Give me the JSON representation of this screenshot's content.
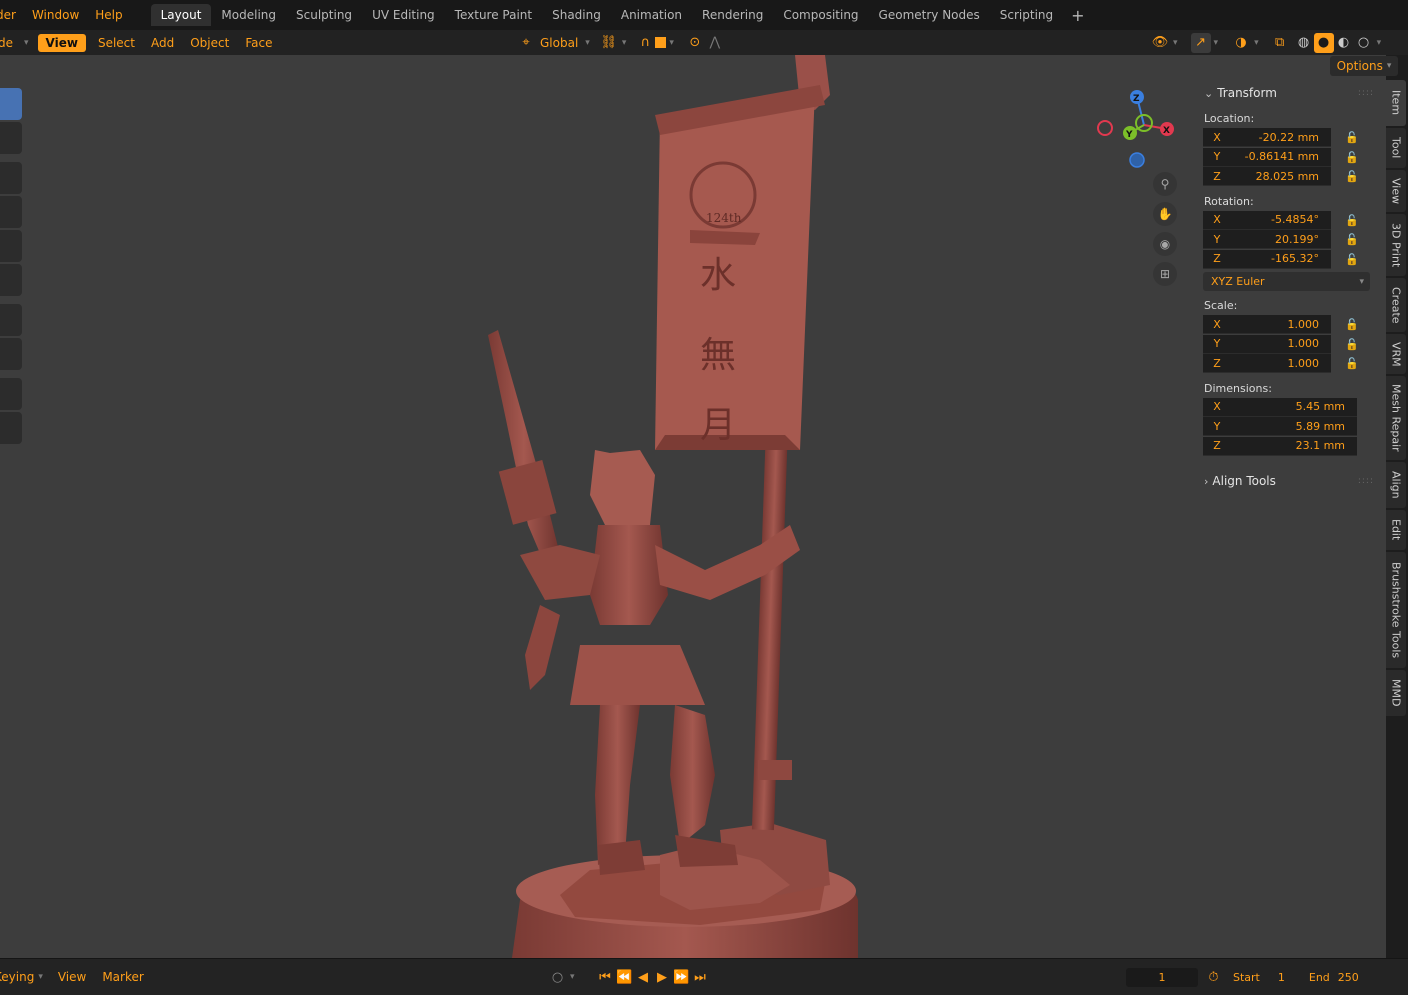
{
  "menu": {
    "items": [
      "der",
      "Window",
      "Help"
    ]
  },
  "workspaces": {
    "tabs": [
      "Layout",
      "Modeling",
      "Sculpting",
      "UV Editing",
      "Texture Paint",
      "Shading",
      "Animation",
      "Rendering",
      "Compositing",
      "Geometry Nodes",
      "Scripting"
    ],
    "active": "Layout",
    "add_icon": "plus-icon"
  },
  "header": {
    "mode": "de",
    "view": "View",
    "select": "Select",
    "add": "Add",
    "object": "Object",
    "face": "Face",
    "transform_orientation": "Global"
  },
  "viewport": {
    "options_label": "Options",
    "gizmo": {
      "z": "Z",
      "y": "Y",
      "x": "X"
    }
  },
  "transform_panel": {
    "title": "Transform",
    "location": {
      "label": "Location:",
      "x": {
        "axis": "X",
        "value": "-20.22 mm"
      },
      "y": {
        "axis": "Y",
        "value": "-0.86141 mm"
      },
      "z": {
        "axis": "Z",
        "value": "28.025 mm"
      }
    },
    "rotation": {
      "label": "Rotation:",
      "x": {
        "axis": "X",
        "value": "-5.4854°"
      },
      "y": {
        "axis": "Y",
        "value": "20.199°"
      },
      "z": {
        "axis": "Z",
        "value": "-165.32°"
      },
      "mode": "XYZ Euler"
    },
    "scale": {
      "label": "Scale:",
      "x": {
        "axis": "X",
        "value": "1.000"
      },
      "y": {
        "axis": "Y",
        "value": "1.000"
      },
      "z": {
        "axis": "Z",
        "value": "1.000"
      }
    },
    "dimensions": {
      "label": "Dimensions:",
      "x": {
        "axis": "X",
        "value": "5.45 mm"
      },
      "y": {
        "axis": "Y",
        "value": "5.89 mm"
      },
      "z": {
        "axis": "Z",
        "value": "23.1 mm"
      }
    }
  },
  "align_tools": {
    "title": "Align Tools"
  },
  "side_tabs": [
    "Item",
    "Tool",
    "View",
    "3D Print",
    "Create",
    "VRM",
    "Mesh Repair",
    "Align",
    "Edit",
    "Brushstroke Tools",
    "MMD"
  ],
  "model": {
    "banner_top": "124th",
    "banner_chars": [
      "水",
      "無",
      "月"
    ]
  },
  "timeline": {
    "keying": "Keying",
    "view": "View",
    "marker": "Marker",
    "current_frame": "1",
    "start_label": "Start",
    "start_value": "1",
    "end_label": "End",
    "end_value": "250"
  },
  "colors": {
    "accent": "#ff9f1a",
    "active_tool": "#4772b3",
    "model": "#9b4f47",
    "axis_x": "#e2394f",
    "axis_y": "#7cbf29",
    "axis_z": "#3a7fe0"
  }
}
